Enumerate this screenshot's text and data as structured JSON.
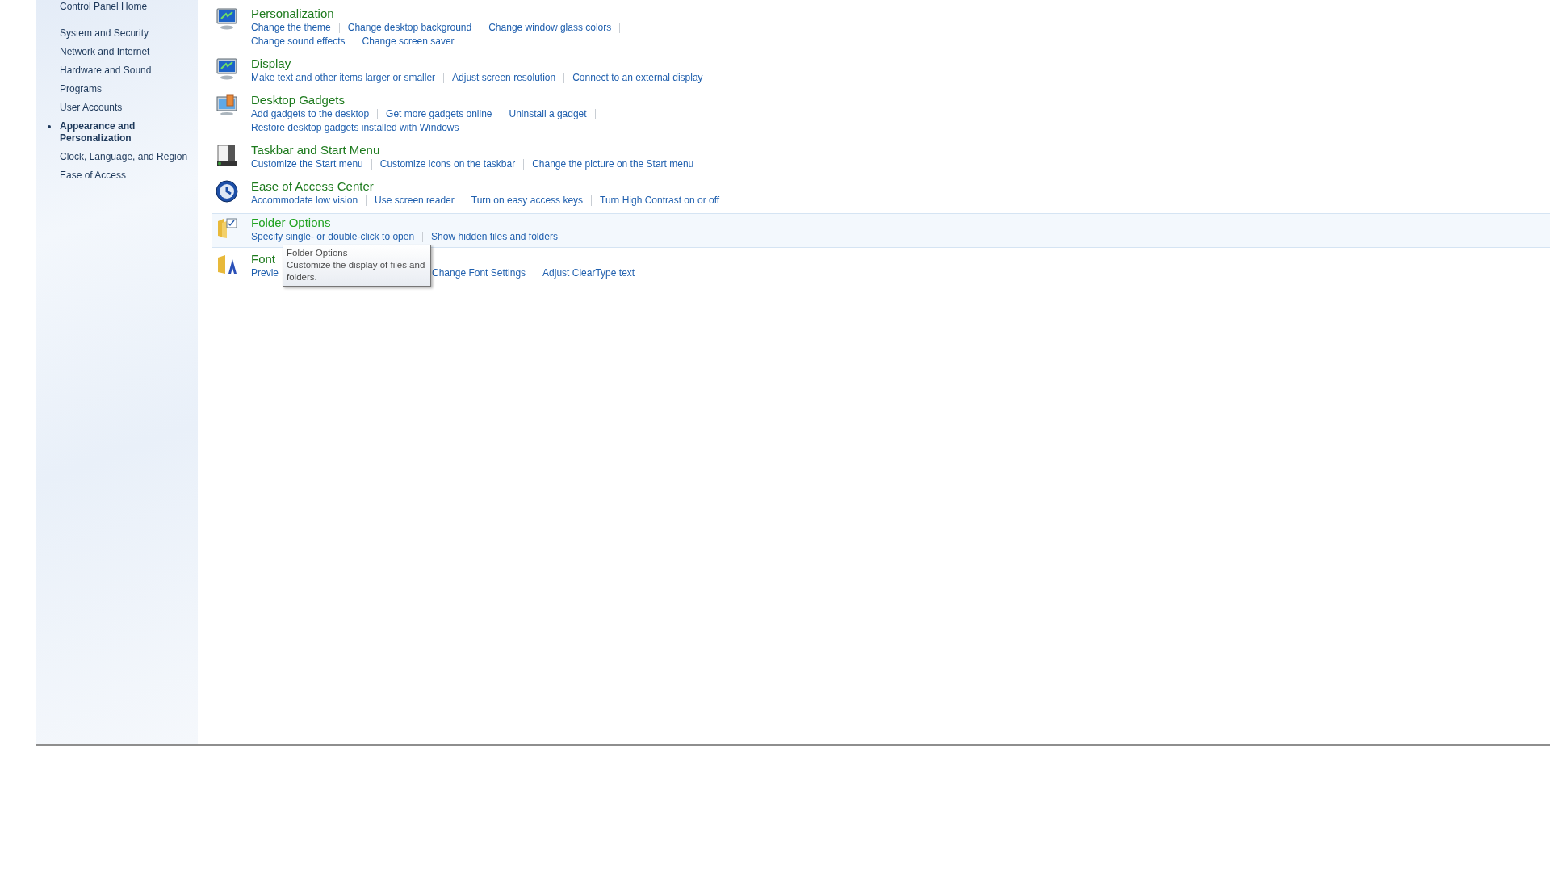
{
  "sidebar": {
    "home": "Control Panel Home",
    "items": [
      {
        "label": "System and Security",
        "selected": false
      },
      {
        "label": "Network and Internet",
        "selected": false
      },
      {
        "label": "Hardware and Sound",
        "selected": false
      },
      {
        "label": "Programs",
        "selected": false
      },
      {
        "label": "User Accounts",
        "selected": false
      },
      {
        "label": "Appearance and Personalization",
        "selected": true
      },
      {
        "label": "Clock, Language, and Region",
        "selected": false
      },
      {
        "label": "Ease of Access",
        "selected": false
      }
    ]
  },
  "sections": [
    {
      "title": "Personalization",
      "highlighted": false,
      "lines": [
        [
          {
            "text": "Change the theme"
          },
          {
            "text": "Change desktop background"
          },
          {
            "text": "Change window glass colors"
          }
        ],
        [
          {
            "text": "Change sound effects"
          },
          {
            "text": "Change screen saver"
          }
        ]
      ]
    },
    {
      "title": "Display",
      "highlighted": false,
      "lines": [
        [
          {
            "text": "Make text and other items larger or smaller"
          },
          {
            "text": "Adjust screen resolution"
          },
          {
            "text": "Connect to an external display"
          }
        ]
      ]
    },
    {
      "title": "Desktop Gadgets",
      "highlighted": false,
      "lines": [
        [
          {
            "text": "Add gadgets to the desktop"
          },
          {
            "text": "Get more gadgets online"
          },
          {
            "text": "Uninstall a gadget"
          }
        ],
        [
          {
            "text": "Restore desktop gadgets installed with Windows"
          }
        ]
      ]
    },
    {
      "title": "Taskbar and Start Menu",
      "highlighted": false,
      "lines": [
        [
          {
            "text": "Customize the Start menu"
          },
          {
            "text": "Customize icons on the taskbar"
          },
          {
            "text": "Change the picture on the Start menu"
          }
        ]
      ]
    },
    {
      "title": "Ease of Access Center",
      "highlighted": false,
      "lines": [
        [
          {
            "text": "Accommodate low vision"
          },
          {
            "text": "Use screen reader"
          },
          {
            "text": "Turn on easy access keys"
          },
          {
            "text": "Turn High Contrast on or off"
          }
        ]
      ]
    },
    {
      "title": "Folder Options",
      "highlighted": true,
      "tooltip": {
        "title": "Folder Options",
        "text": "Customize the display of files and folders."
      },
      "lines": [
        [
          {
            "text": "Specify single- or double-click to open"
          },
          {
            "text": "Show hidden files and folders"
          }
        ]
      ]
    },
    {
      "title": "Font",
      "highlighted": false,
      "lines": [
        [
          {
            "text": "Previe",
            "covered": true
          },
          {
            "text": "Change Font Settings"
          },
          {
            "text": "Adjust ClearType text"
          }
        ]
      ]
    }
  ]
}
